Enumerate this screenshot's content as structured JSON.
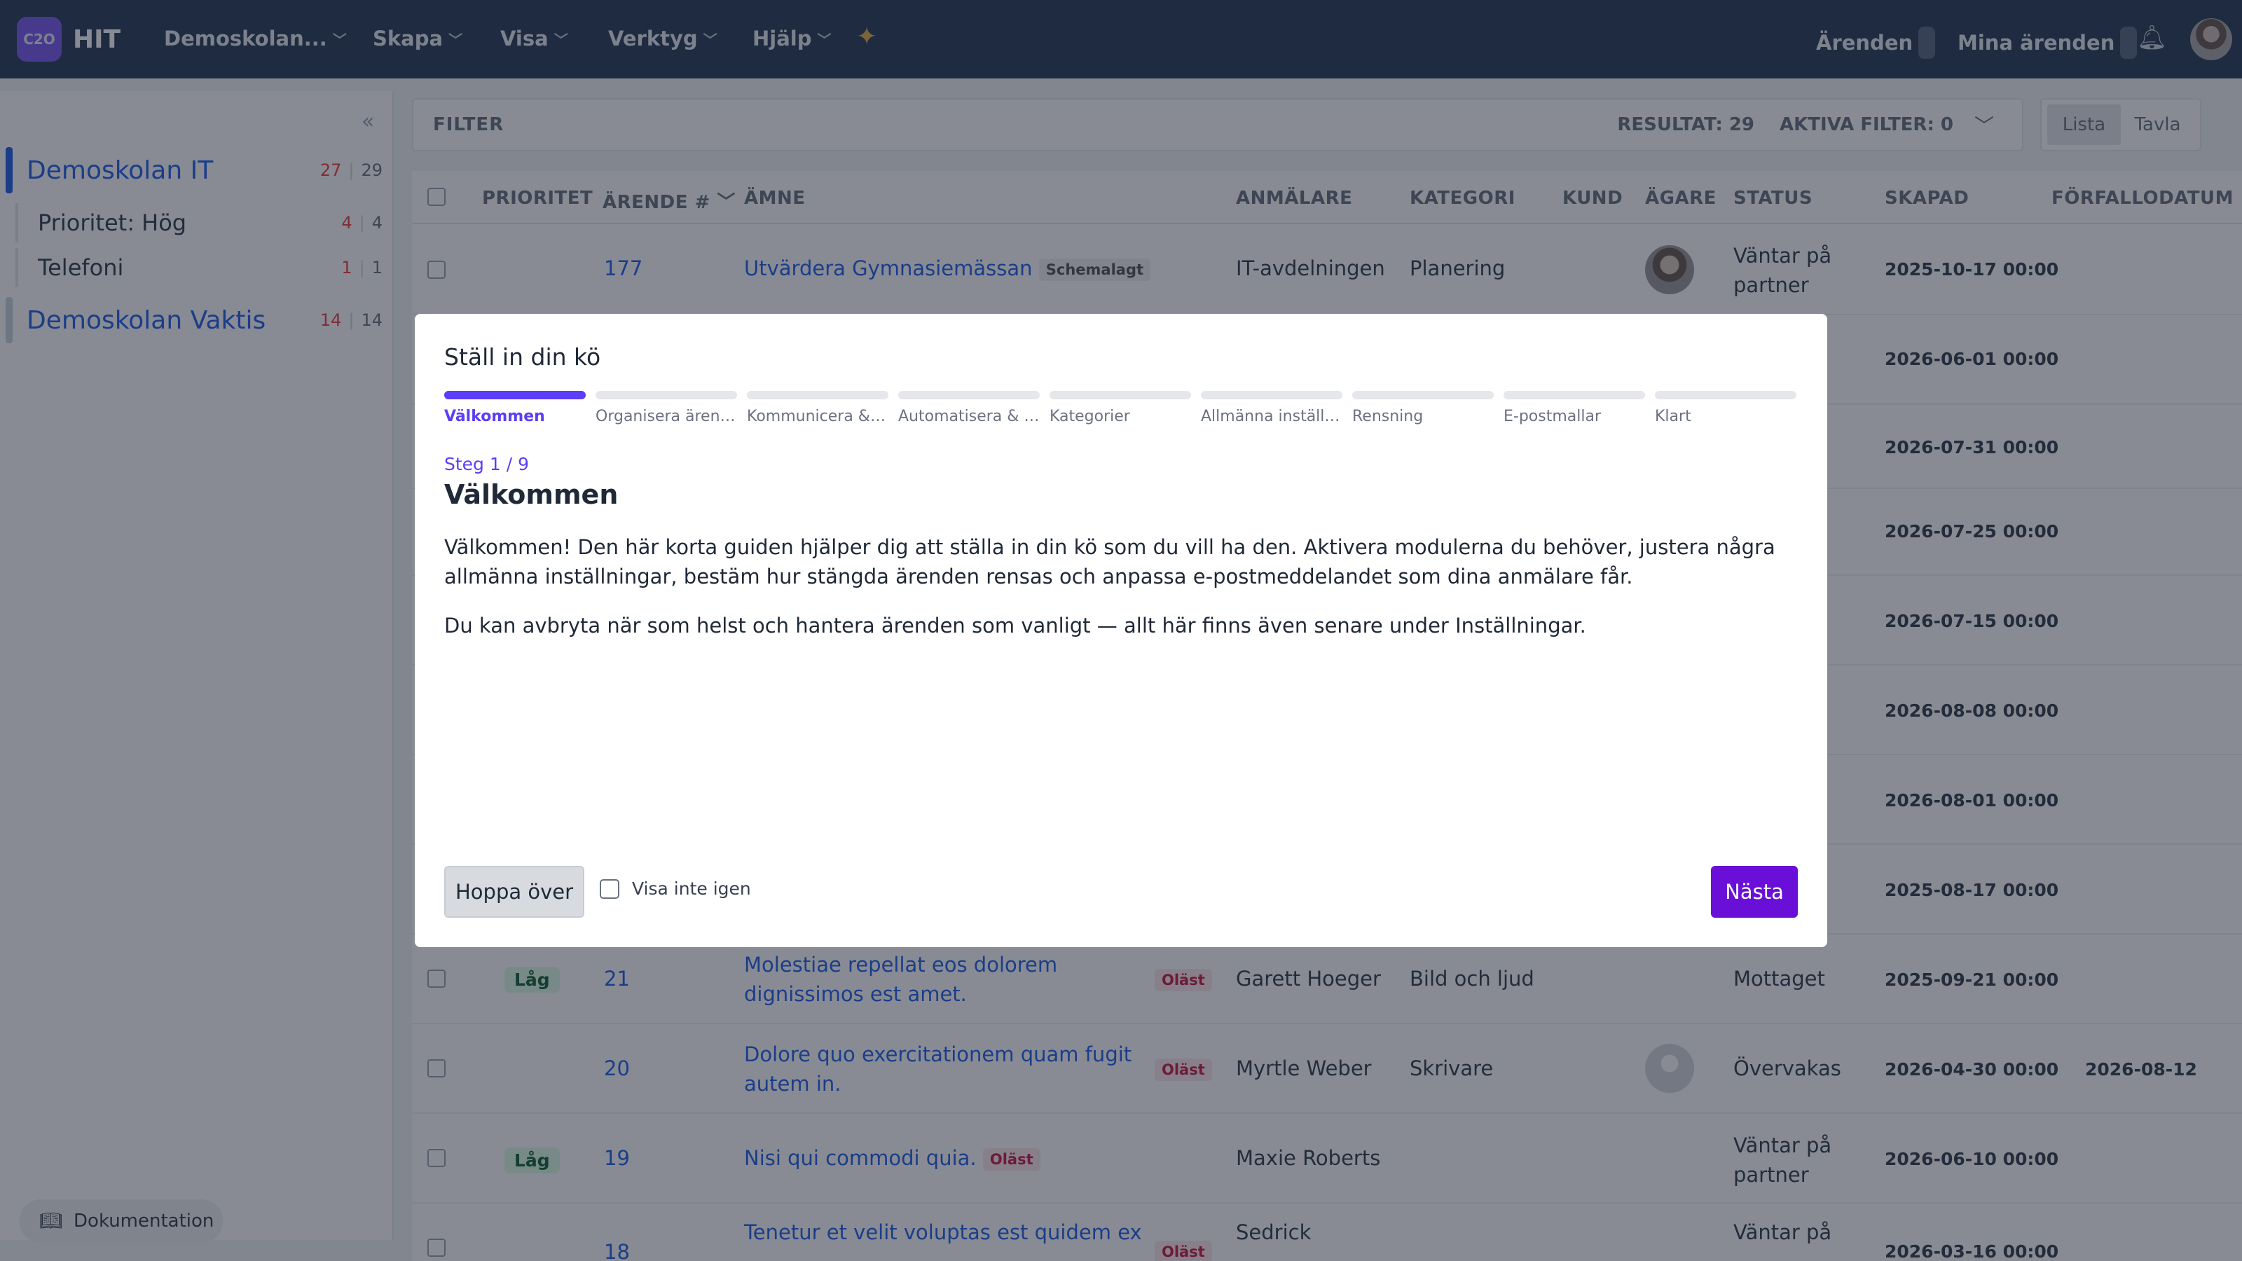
{
  "app": {
    "brand": "HIT",
    "logo_text": "C2O"
  },
  "nav": [
    {
      "label": "Demoskolan..."
    },
    {
      "label": "Skapa"
    },
    {
      "label": "Visa"
    },
    {
      "label": "Verktyg"
    },
    {
      "label": "Hjälp"
    }
  ],
  "topright": {
    "tickets": "Ärenden",
    "my_tickets": "Mina ärenden"
  },
  "sidebar": {
    "queues": [
      {
        "name": "Demoskolan IT",
        "red": "27",
        "total": "29"
      },
      {
        "name": "Demoskolan Vaktis",
        "red": "14",
        "total": "14"
      }
    ],
    "subitems": [
      {
        "name": "Prioritet: Hög",
        "red": "4",
        "total": "4"
      },
      {
        "name": "Telefoni",
        "red": "1",
        "total": "1"
      }
    ],
    "docs": "Dokumentation"
  },
  "filter": {
    "label": "FILTER",
    "result": "RESULTAT: 29",
    "active": "AKTIVA FILTER: 0"
  },
  "view": {
    "list": "Lista",
    "board": "Tavla"
  },
  "table": {
    "headers": {
      "priority": "PRIORITET",
      "ticket": "ÄRENDE #",
      "subject": "ÄMNE",
      "reporter": "ANMÄLARE",
      "category": "KATEGORI",
      "customer": "KUND",
      "owner": "ÄGARE",
      "status": "STATUS",
      "created": "SKAPAD",
      "due": "FÖRFALLODATUM"
    },
    "rows": [
      {
        "id": "177",
        "subject": "Utvärdera Gymnasiemässan",
        "badge": "Schemalagt",
        "reporter": "IT-avdelningen",
        "category": "Planering",
        "status1": "Väntar på",
        "status2": "partner",
        "created": "2025-10-17 00:00",
        "priority": "",
        "due": ""
      },
      {
        "created": "2026-06-01 00:00"
      },
      {
        "created": "2026-07-31 00:00"
      },
      {
        "created": "2026-07-25 00:00"
      },
      {
        "created": "2026-07-15 00:00"
      },
      {
        "created": "2026-08-08 00:00"
      },
      {
        "created": "2026-08-01 00:00"
      },
      {
        "created": "2025-08-17 00:00"
      },
      {
        "id": "21",
        "subject1": "Molestiae repellat eos dolorem",
        "subject2": "dignissimos est amet.",
        "badge": "Oläst",
        "reporter": "Garett Hoeger",
        "category": "Bild och ljud",
        "status1": "Mottaget",
        "created": "2025-09-21 00:00",
        "priority": "Låg"
      },
      {
        "id": "20",
        "subject1": "Dolore quo exercitationem quam fugit",
        "subject2": "autem in.",
        "badge": "Oläst",
        "reporter": "Myrtle Weber",
        "category": "Skrivare",
        "status1": "Övervakas",
        "created": "2026-04-30 00:00",
        "due": "2026-08-12"
      },
      {
        "id": "19",
        "subject": "Nisi qui commodi quia.",
        "badge": "Oläst",
        "reporter": "Maxie Roberts",
        "status1": "Väntar på",
        "status2": "partner",
        "created": "2026-06-10 00:00",
        "priority": "Låg"
      },
      {
        "id": "18",
        "subject1": "Tenetur et velit voluptas est quidem ex",
        "badge": "Oläst",
        "reporter1": "Sedrick",
        "status1": "Väntar på",
        "created": "2026-03-16 00:00"
      }
    ]
  },
  "modal": {
    "title": "Ställ in din kö",
    "steps": [
      {
        "label": "Välkommen"
      },
      {
        "label": "Organisera ärend..."
      },
      {
        "label": "Kommunicera & s..."
      },
      {
        "label": "Automatisera & a..."
      },
      {
        "label": "Kategorier"
      },
      {
        "label": "Allmänna inställn..."
      },
      {
        "label": "Rensning"
      },
      {
        "label": "E-postmallar"
      },
      {
        "label": "Klart"
      }
    ],
    "step_count": "Steg 1 / 9",
    "heading": "Välkommen",
    "para1": "Välkommen! Den här korta guiden hjälper dig att ställa in din kö som du vill ha den. Aktivera modulerna du behöver, justera några allmänna inställningar, bestäm hur stängda ärenden rensas och anpassa e-postmeddelandet som dina anmälare får.",
    "para2": "Du kan avbryta när som helst och hantera ärenden som vanligt — allt här finns även senare under Inställningar.",
    "skip": "Hoppa över",
    "dont_show": "Visa inte igen",
    "next": "Nästa"
  },
  "icons": {
    "bell": "bell-icon",
    "sparkle": "sparkle-icon",
    "book": "book-icon",
    "collapse": "collapse-left-icon"
  },
  "colors": {
    "topbar": "#2b3e58",
    "primary": "#6a0fd8",
    "step_active": "#5b3ef5",
    "link": "#2563eb"
  }
}
